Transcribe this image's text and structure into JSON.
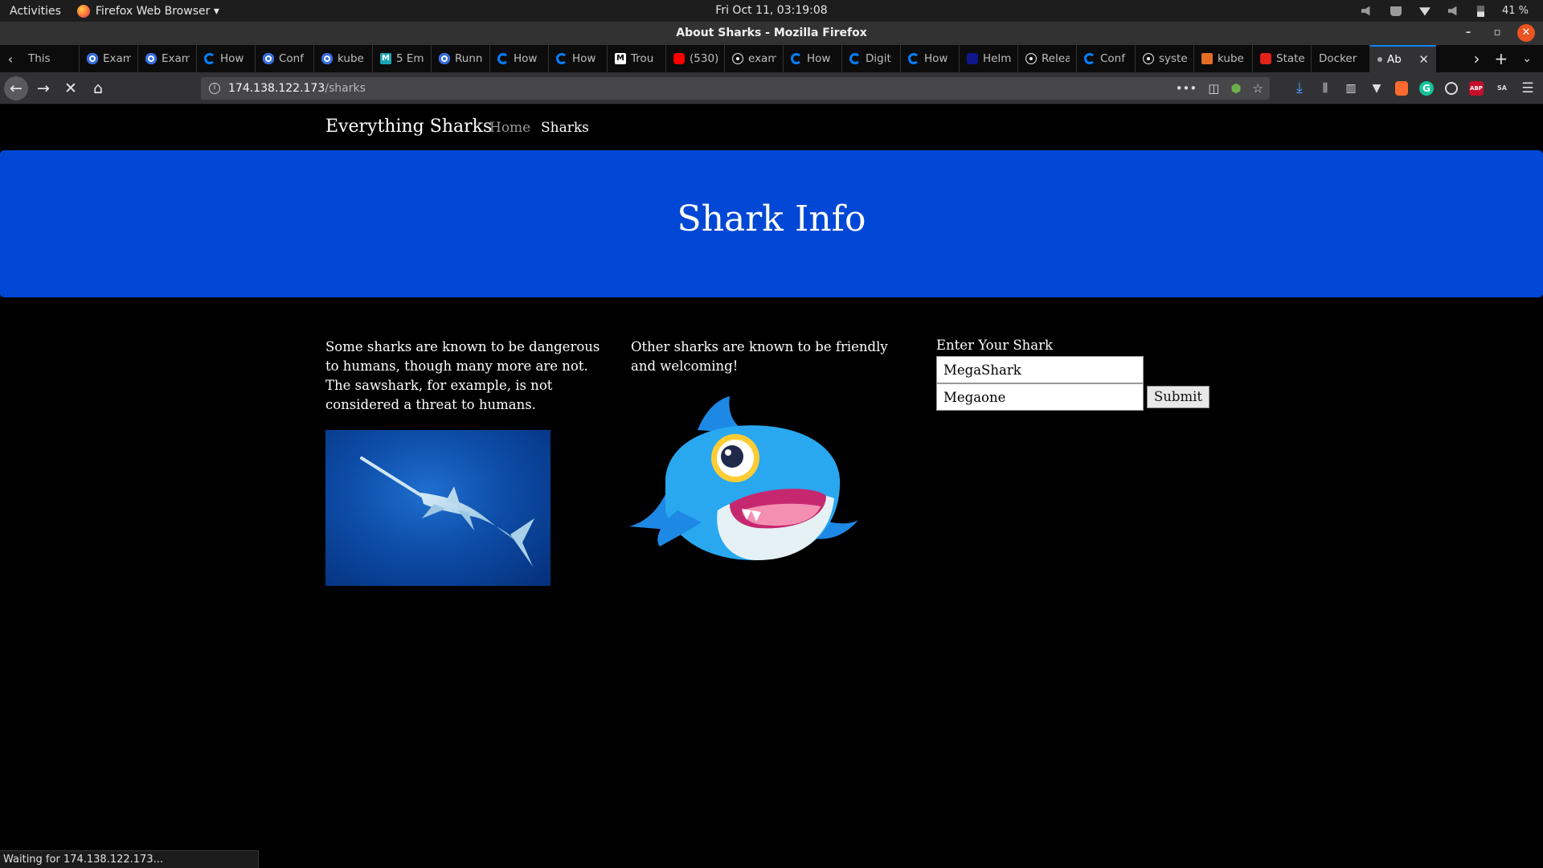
{
  "gnome": {
    "activities": "Activities",
    "app_menu": "Firefox Web Browser ▾",
    "clock": "Fri Oct 11, 03:19:08",
    "battery": "41 %"
  },
  "window": {
    "title": "About Sharks - Mozilla Firefox",
    "minimize": "–",
    "maximize": "▫",
    "close": "✕"
  },
  "tabs": [
    {
      "label": "This",
      "icon": "blank-icon"
    },
    {
      "label": "Exam",
      "icon": "kubernetes-icon"
    },
    {
      "label": "Exam",
      "icon": "kubernetes-icon"
    },
    {
      "label": "How",
      "icon": "digitalocean-icon"
    },
    {
      "label": "Conf",
      "icon": "kubernetes-icon"
    },
    {
      "label": "kube",
      "icon": "kubernetes-icon"
    },
    {
      "label": "5 Em",
      "icon": "m-icon"
    },
    {
      "label": "Runn",
      "icon": "kubernetes-icon"
    },
    {
      "label": "How",
      "icon": "digitalocean-icon"
    },
    {
      "label": "How",
      "icon": "digitalocean-icon"
    },
    {
      "label": "Trou",
      "icon": "medium-icon"
    },
    {
      "label": "(530)",
      "icon": "youtube-icon"
    },
    {
      "label": "exam",
      "icon": "github-icon"
    },
    {
      "label": "How",
      "icon": "digitalocean-icon"
    },
    {
      "label": "Digit",
      "icon": "digitalocean-icon"
    },
    {
      "label": "How",
      "icon": "digitalocean-icon"
    },
    {
      "label": "Helm",
      "icon": "helm-icon"
    },
    {
      "label": "Relea",
      "icon": "github-icon"
    },
    {
      "label": "Conf",
      "icon": "digitalocean-icon"
    },
    {
      "label": "syste",
      "icon": "github-icon"
    },
    {
      "label": "kube",
      "icon": "kube-icon"
    },
    {
      "label": "State",
      "icon": "state-icon"
    },
    {
      "label": "Docker",
      "icon": "none"
    },
    {
      "label": "Ab",
      "icon": "loading-icon",
      "active": true
    }
  ],
  "toolbar": {
    "url_host": "174.138.122.173",
    "url_path": "/sharks",
    "page_actions": "•••"
  },
  "site": {
    "brand": "Everything Sharks",
    "nav_home": "Home",
    "nav_sharks": "Sharks",
    "hero_title": "Shark Info",
    "col1_text": "Some sharks are known to be dangerous to humans, though many more are not. The sawshark, for example, is not considered a threat to humans.",
    "col2_text": "Other sharks are known to be friendly and welcoming!",
    "form": {
      "label": "Enter Your Shark",
      "name_value": "MegaShark",
      "character_value": "Megaone",
      "submit_label": "Submit"
    }
  },
  "status": "Waiting for 174.138.122.173...",
  "colors": {
    "hero_bg": "#0047d6",
    "page_bg": "#000000",
    "accent": "#0a84ff",
    "ubuntu_close": "#e95420"
  }
}
